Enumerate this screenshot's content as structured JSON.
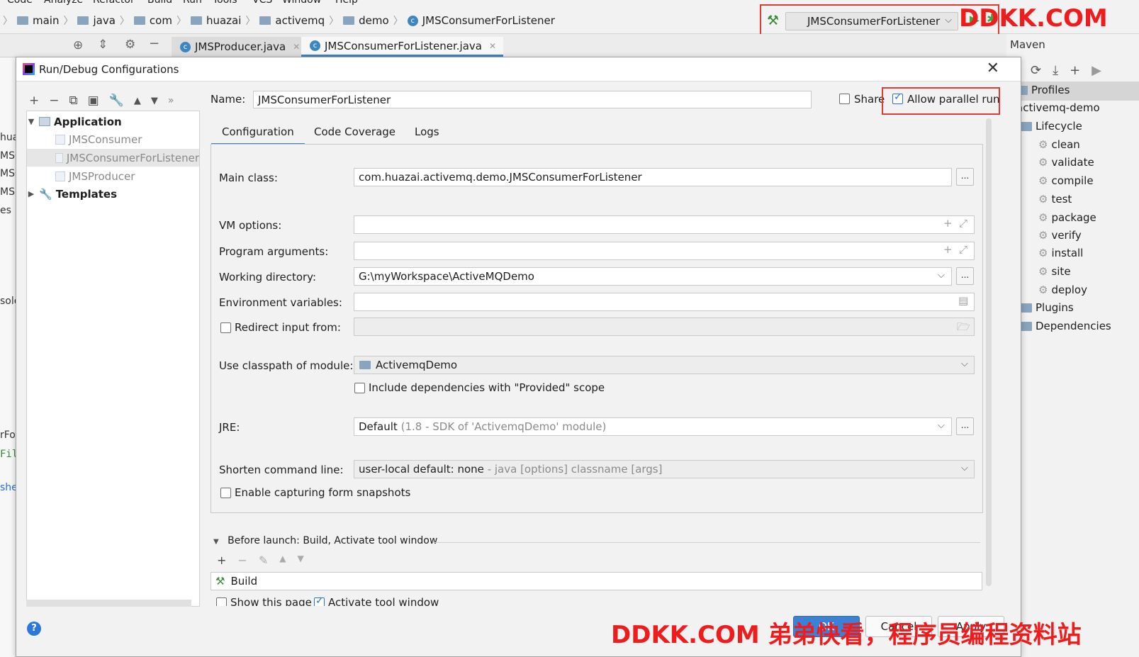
{
  "menubar": {
    "items": [
      "Code",
      "Analyze",
      "Refactor",
      "Build",
      "Run",
      "Tools",
      "VCS",
      "Window",
      "Help"
    ]
  },
  "breadcrumb": {
    "items": [
      "main",
      "java",
      "com",
      "huazai",
      "activemq",
      "demo",
      "JMSConsumerForListener"
    ]
  },
  "run_config": {
    "selected": "JMSConsumerForListener"
  },
  "editor_tabs": [
    {
      "label": "JMSProducer.java"
    },
    {
      "label": "JMSConsumerForListener.java"
    }
  ],
  "maven": {
    "title": "Maven",
    "items": {
      "profiles": "Profiles",
      "project": "activemq-demo",
      "lifecycle": "Lifecycle",
      "phases": [
        "clean",
        "validate",
        "compile",
        "test",
        "package",
        "verify",
        "install",
        "site",
        "deploy"
      ],
      "plugins": "Plugins",
      "dependencies": "Dependencies"
    }
  },
  "left_strip": [
    "hua",
    "MSC",
    "MSC",
    "MSP",
    "es",
    "sole",
    "rFo",
    "Fil",
    "she"
  ],
  "dialog": {
    "title": "Run/Debug Configurations",
    "tree": {
      "application": "Application",
      "configs": [
        "JMSConsumer",
        "JMSConsumerForListener",
        "JMSProducer"
      ],
      "templates": "Templates"
    },
    "name_label": "Name:",
    "name_value": "JMSConsumerForListener",
    "share_label": "Share",
    "share_checked": false,
    "parallel_label": "Allow parallel run",
    "parallel_checked": true,
    "tabs": [
      "Configuration",
      "Code Coverage",
      "Logs"
    ],
    "form": {
      "main_class_label": "Main class:",
      "main_class_value": "com.huazai.activemq.demo.JMSConsumerForListener",
      "vm_options_label": "VM options:",
      "vm_options_value": "",
      "program_args_label": "Program arguments:",
      "program_args_value": "",
      "working_dir_label": "Working directory:",
      "working_dir_value": "G:\\myWorkspace\\ActiveMQDemo",
      "env_vars_label": "Environment variables:",
      "env_vars_value": "",
      "redirect_label": "Redirect input from:",
      "redirect_checked": false,
      "classpath_label": "Use classpath of module:",
      "classpath_value": "ActivemqDemo",
      "include_deps_label": "Include dependencies with \"Provided\" scope",
      "include_deps_checked": false,
      "jre_label": "JRE:",
      "jre_value": "Default",
      "jre_hint": "(1.8 - SDK of 'ActivemqDemo' module)",
      "shorten_label": "Shorten command line:",
      "shorten_value": "user-local default: none",
      "shorten_hint": "- java [options] classname [args]",
      "snapshots_label": "Enable capturing form snapshots",
      "snapshots_checked": false
    },
    "before_launch": {
      "label": "Before launch: Build, Activate tool window",
      "task": "Build",
      "show_page_label": "Show this page",
      "activate_label": "Activate tool window"
    },
    "buttons": {
      "ok": "OK",
      "cancel": "Cancel",
      "apply": "Apply"
    }
  },
  "watermarks": {
    "top": "DDKK.COM",
    "bottom": "DDKK.COM 弟弟快看，程序员编程资料站"
  },
  "colors": {
    "accent": "#4083c9",
    "highlight_box": "#e53935",
    "watermark": "#ee1c1c",
    "run_green": "#3fa33f"
  }
}
